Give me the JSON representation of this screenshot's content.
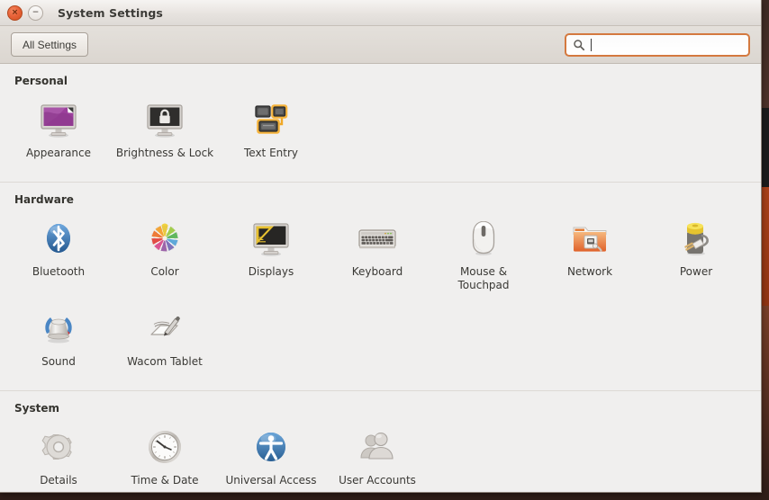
{
  "window": {
    "title": "System Settings",
    "close_label": "×",
    "minimize_label": "−"
  },
  "toolbar": {
    "all_settings_label": "All Settings",
    "search_placeholder": "",
    "search_value": "",
    "search_icon": "search-icon"
  },
  "sections": [
    {
      "title": "Personal",
      "items": [
        {
          "label": "Appearance",
          "icon": "appearance-icon"
        },
        {
          "label": "Brightness & Lock",
          "icon": "brightness-lock-icon"
        },
        {
          "label": "Text Entry",
          "icon": "text-entry-icon"
        }
      ]
    },
    {
      "title": "Hardware",
      "items": [
        {
          "label": "Bluetooth",
          "icon": "bluetooth-icon"
        },
        {
          "label": "Color",
          "icon": "color-icon"
        },
        {
          "label": "Displays",
          "icon": "displays-icon"
        },
        {
          "label": "Keyboard",
          "icon": "keyboard-icon"
        },
        {
          "label": "Mouse & Touchpad",
          "icon": "mouse-touchpad-icon"
        },
        {
          "label": "Network",
          "icon": "network-icon"
        },
        {
          "label": "Power",
          "icon": "power-icon"
        },
        {
          "label": "Sound",
          "icon": "sound-icon"
        },
        {
          "label": "Wacom Tablet",
          "icon": "wacom-tablet-icon"
        }
      ]
    },
    {
      "title": "System",
      "items": [
        {
          "label": "Details",
          "icon": "details-icon"
        },
        {
          "label": "Time & Date",
          "icon": "time-date-icon"
        },
        {
          "label": "Universal Access",
          "icon": "universal-access-icon"
        },
        {
          "label": "User Accounts",
          "icon": "user-accounts-icon"
        }
      ]
    }
  ],
  "colors": {
    "accent_orange": "#d4793f",
    "close_button": "#e8633a",
    "window_bg": "#f0efee",
    "titlebar_bg": "#e7e3df",
    "text": "#3a3935"
  }
}
